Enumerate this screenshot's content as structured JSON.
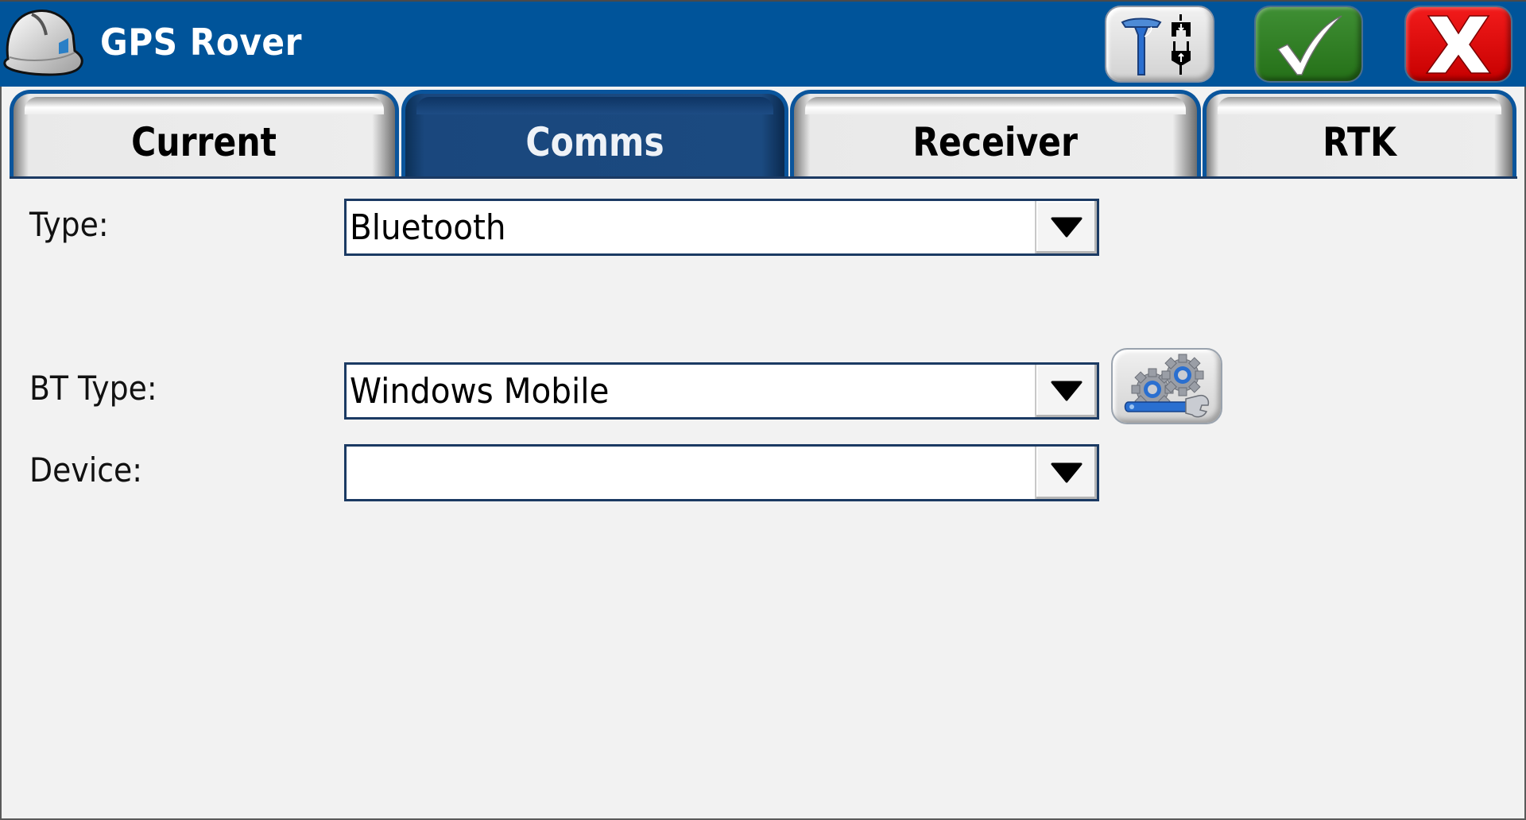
{
  "header": {
    "title": "GPS Rover",
    "logo_icon": "hard-hat-icon",
    "buttons": [
      {
        "name": "gps-connect-button",
        "icon": "gps-antenna-plug-icon"
      },
      {
        "name": "accept-button",
        "icon": "checkmark-icon",
        "color": "#2e7d23"
      },
      {
        "name": "cancel-button",
        "icon": "close-x-icon",
        "color": "#e00000"
      }
    ]
  },
  "colors": {
    "header_bg": "#00549a",
    "active_tab": "#1b4a80",
    "tab_border": "#0a559c"
  },
  "tabs": [
    {
      "label": "Current",
      "active": false
    },
    {
      "label": "Comms",
      "active": true
    },
    {
      "label": "Receiver",
      "active": false
    },
    {
      "label": "RTK",
      "active": false
    }
  ],
  "form": {
    "type": {
      "label": "Type:",
      "value": "Bluetooth"
    },
    "bt_type": {
      "label": "BT Type:",
      "value": "Windows Mobile",
      "settings_icon": "gears-wrench-icon"
    },
    "device": {
      "label": "Device:",
      "value": ""
    }
  }
}
